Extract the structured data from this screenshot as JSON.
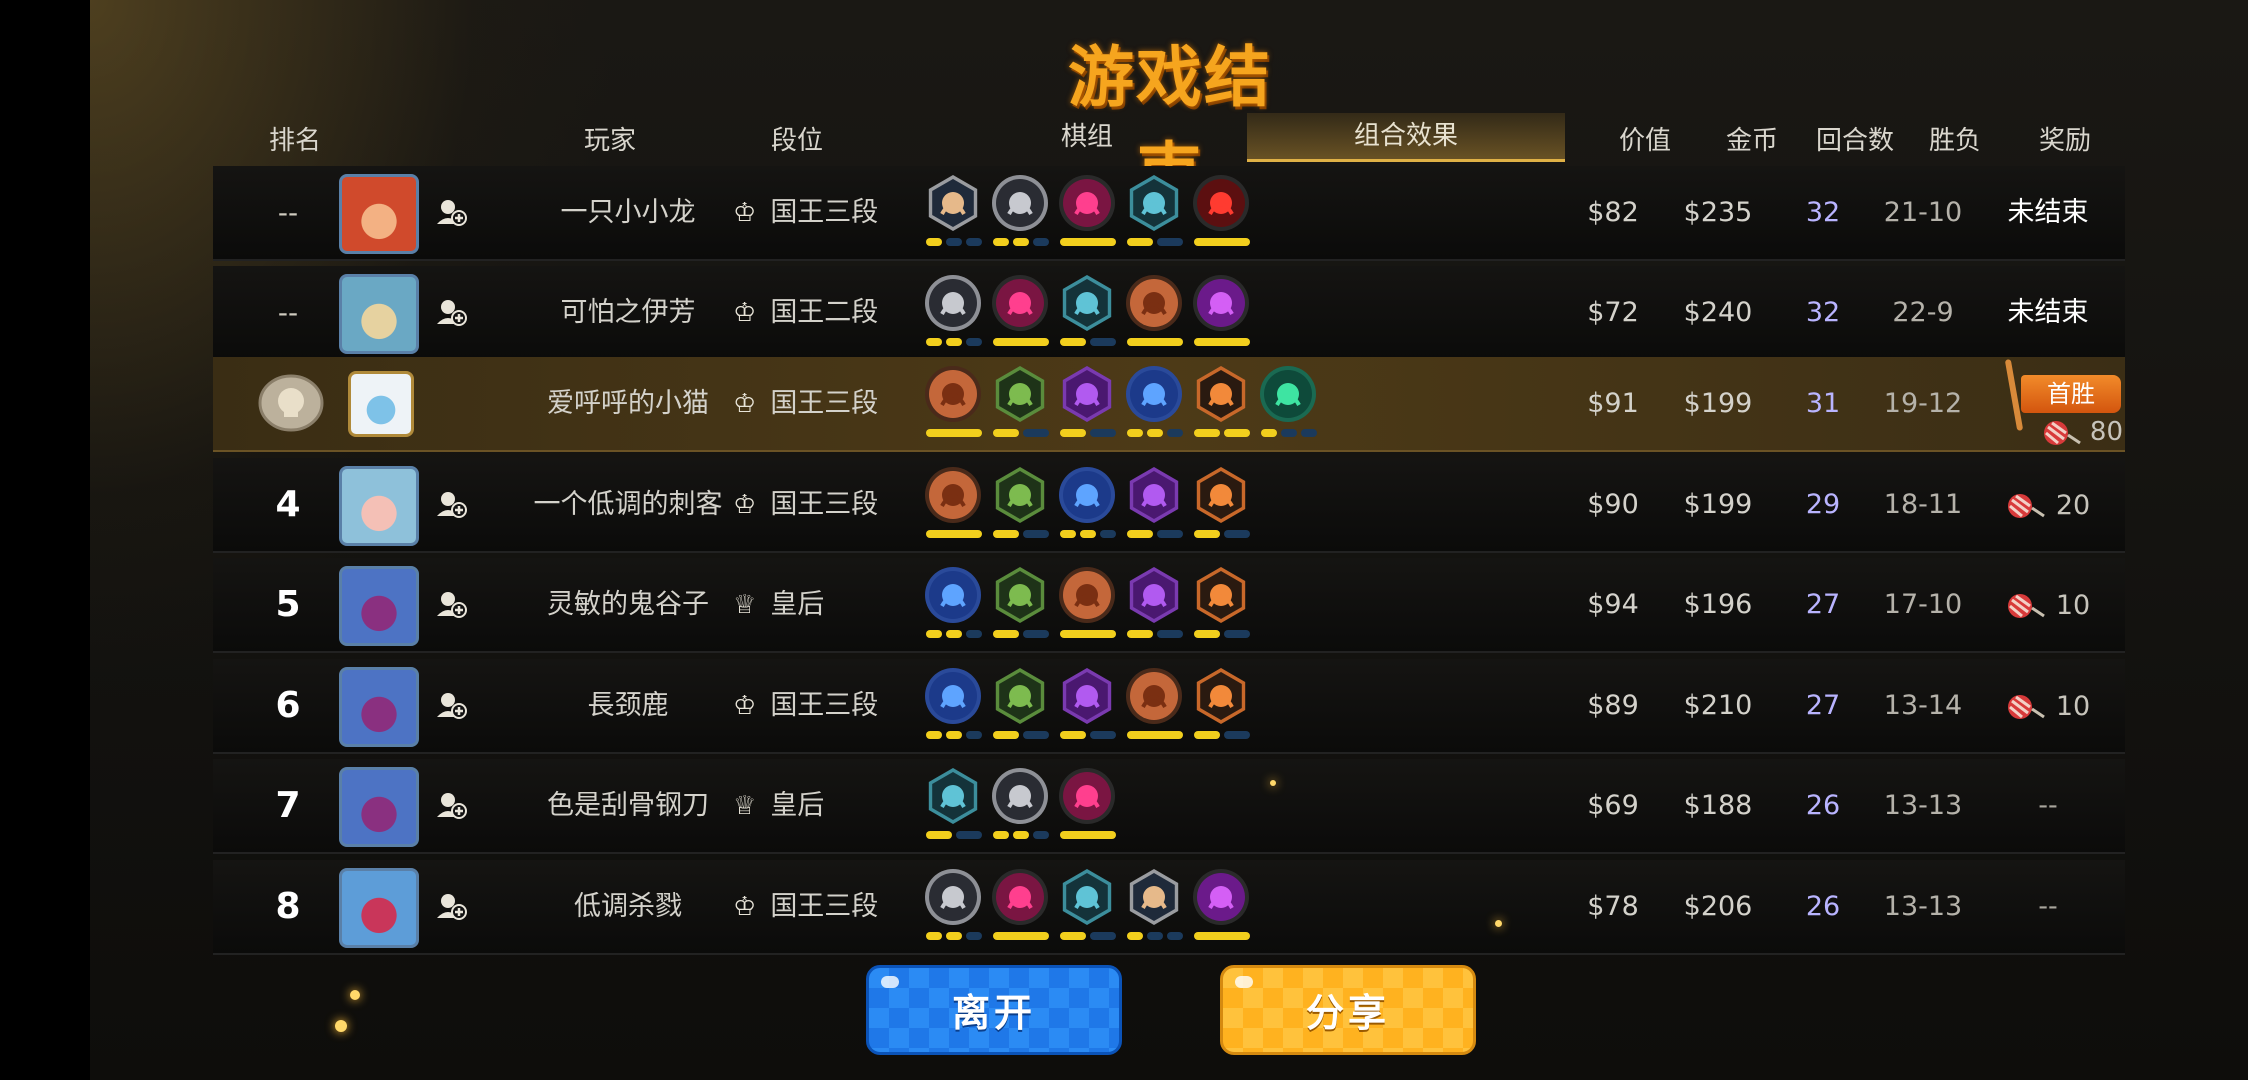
{
  "title": "游戏结束",
  "headers": {
    "rank": "排名",
    "player": "玩家",
    "tier": "段位",
    "pieces": "棋组",
    "synergy": "组合效果",
    "value": "价值",
    "gold": "金币",
    "rounds": "回合数",
    "winloss": "胜负",
    "reward": "奖励"
  },
  "rows": [
    {
      "rank": "--",
      "name": "一只小小龙",
      "tier": "国王三段",
      "tier_icon": "king",
      "value": "$82",
      "gold": "$235",
      "rounds": "32",
      "wl": "21-10",
      "reward": "未结束",
      "avatar": "red-dragon",
      "synergies": [
        "warrior",
        "knight",
        "demon",
        "mage",
        "sea"
      ],
      "levels": [
        [
          1,
          0,
          0
        ],
        [
          1,
          1,
          0
        ],
        [
          1
        ],
        [
          1,
          0
        ],
        [
          1
        ]
      ]
    },
    {
      "rank": "--",
      "name": "可怕之伊芳",
      "tier": "国王二段",
      "tier_icon": "king",
      "value": "$72",
      "gold": "$240",
      "rounds": "32",
      "wl": "22-9",
      "reward": "未结束",
      "avatar": "goblin",
      "synergies": [
        "knight",
        "demon",
        "mage",
        "orc",
        "devil"
      ],
      "levels": [
        [
          1,
          1,
          0
        ],
        [
          1
        ],
        [
          1,
          0
        ],
        [
          1
        ],
        [
          1
        ]
      ]
    },
    {
      "rank": "",
      "name": "爱呼呼的小猫",
      "tier": "国王三段",
      "tier_icon": "king",
      "value": "$91",
      "gold": "$199",
      "rounds": "31",
      "wl": "19-12",
      "reward": "首胜",
      "reward_amount": "80",
      "avatar": "bear",
      "me": true,
      "synergies": [
        "orc",
        "hunter",
        "warlock",
        "assassin",
        "druid",
        "beast"
      ],
      "levels": [
        [
          1
        ],
        [
          1,
          0
        ],
        [
          1,
          0
        ],
        [
          1,
          1,
          0
        ],
        [
          1,
          1
        ],
        [
          1,
          0,
          0
        ]
      ]
    },
    {
      "rank": "4",
      "name": "一个低调的刺客",
      "tier": "国王三段",
      "tier_icon": "king",
      "value": "$90",
      "gold": "$199",
      "rounds": "29",
      "wl": "18-11",
      "reward": "20",
      "avatar": "pink-hood",
      "synergies": [
        "orc",
        "hunter",
        "assassin",
        "warlock",
        "druid"
      ],
      "levels": [
        [
          1
        ],
        [
          1,
          0
        ],
        [
          1,
          1,
          0
        ],
        [
          1,
          0
        ],
        [
          1,
          0
        ]
      ]
    },
    {
      "rank": "5",
      "name": "灵敏的鬼谷子",
      "tier": "皇后",
      "tier_icon": "queen",
      "value": "$94",
      "gold": "$196",
      "rounds": "27",
      "wl": "17-10",
      "reward": "10",
      "avatar": "blue-beast",
      "synergies": [
        "assassin",
        "hunter",
        "orc",
        "warlock",
        "druid"
      ],
      "levels": [
        [
          1,
          1,
          0
        ],
        [
          1,
          0
        ],
        [
          1
        ],
        [
          1,
          0
        ],
        [
          1,
          0
        ]
      ]
    },
    {
      "rank": "6",
      "name": "長颈鹿",
      "tier": "国王三段",
      "tier_icon": "king",
      "value": "$89",
      "gold": "$210",
      "rounds": "27",
      "wl": "13-14",
      "reward": "10",
      "avatar": "blue-beast",
      "synergies": [
        "assassin",
        "hunter",
        "warlock",
        "orc",
        "druid"
      ],
      "levels": [
        [
          1,
          1,
          0
        ],
        [
          1,
          0
        ],
        [
          1,
          0
        ],
        [
          1
        ],
        [
          1,
          0
        ]
      ]
    },
    {
      "rank": "7",
      "name": "色是刮骨钢刀",
      "tier": "皇后",
      "tier_icon": "queen",
      "value": "$69",
      "gold": "$188",
      "rounds": "26",
      "wl": "13-13",
      "reward": "--",
      "avatar": "blue-beast",
      "synergies": [
        "mage",
        "knight",
        "demon"
      ],
      "levels": [
        [
          1,
          0
        ],
        [
          1,
          1,
          0
        ],
        [
          1
        ]
      ]
    },
    {
      "rank": "8",
      "name": "低调杀戮",
      "tier": "国王三段",
      "tier_icon": "king",
      "value": "$78",
      "gold": "$206",
      "rounds": "26",
      "wl": "13-13",
      "reward": "--",
      "avatar": "blue-bird",
      "synergies": [
        "knight",
        "demon",
        "mage",
        "warrior",
        "devil"
      ],
      "levels": [
        [
          1,
          1,
          0
        ],
        [
          1
        ],
        [
          1,
          0
        ],
        [
          1,
          0,
          0
        ],
        [
          1
        ]
      ]
    }
  ],
  "buttons": {
    "leave": "离开",
    "share": "分享"
  },
  "colors": {
    "title": "#f6a51e",
    "bar_on": "#f2cf1d",
    "bar_off": "#1b3a5c",
    "rounds": "#b9b4ff",
    "leave": "#1f78e8",
    "share": "#ffb21f"
  }
}
